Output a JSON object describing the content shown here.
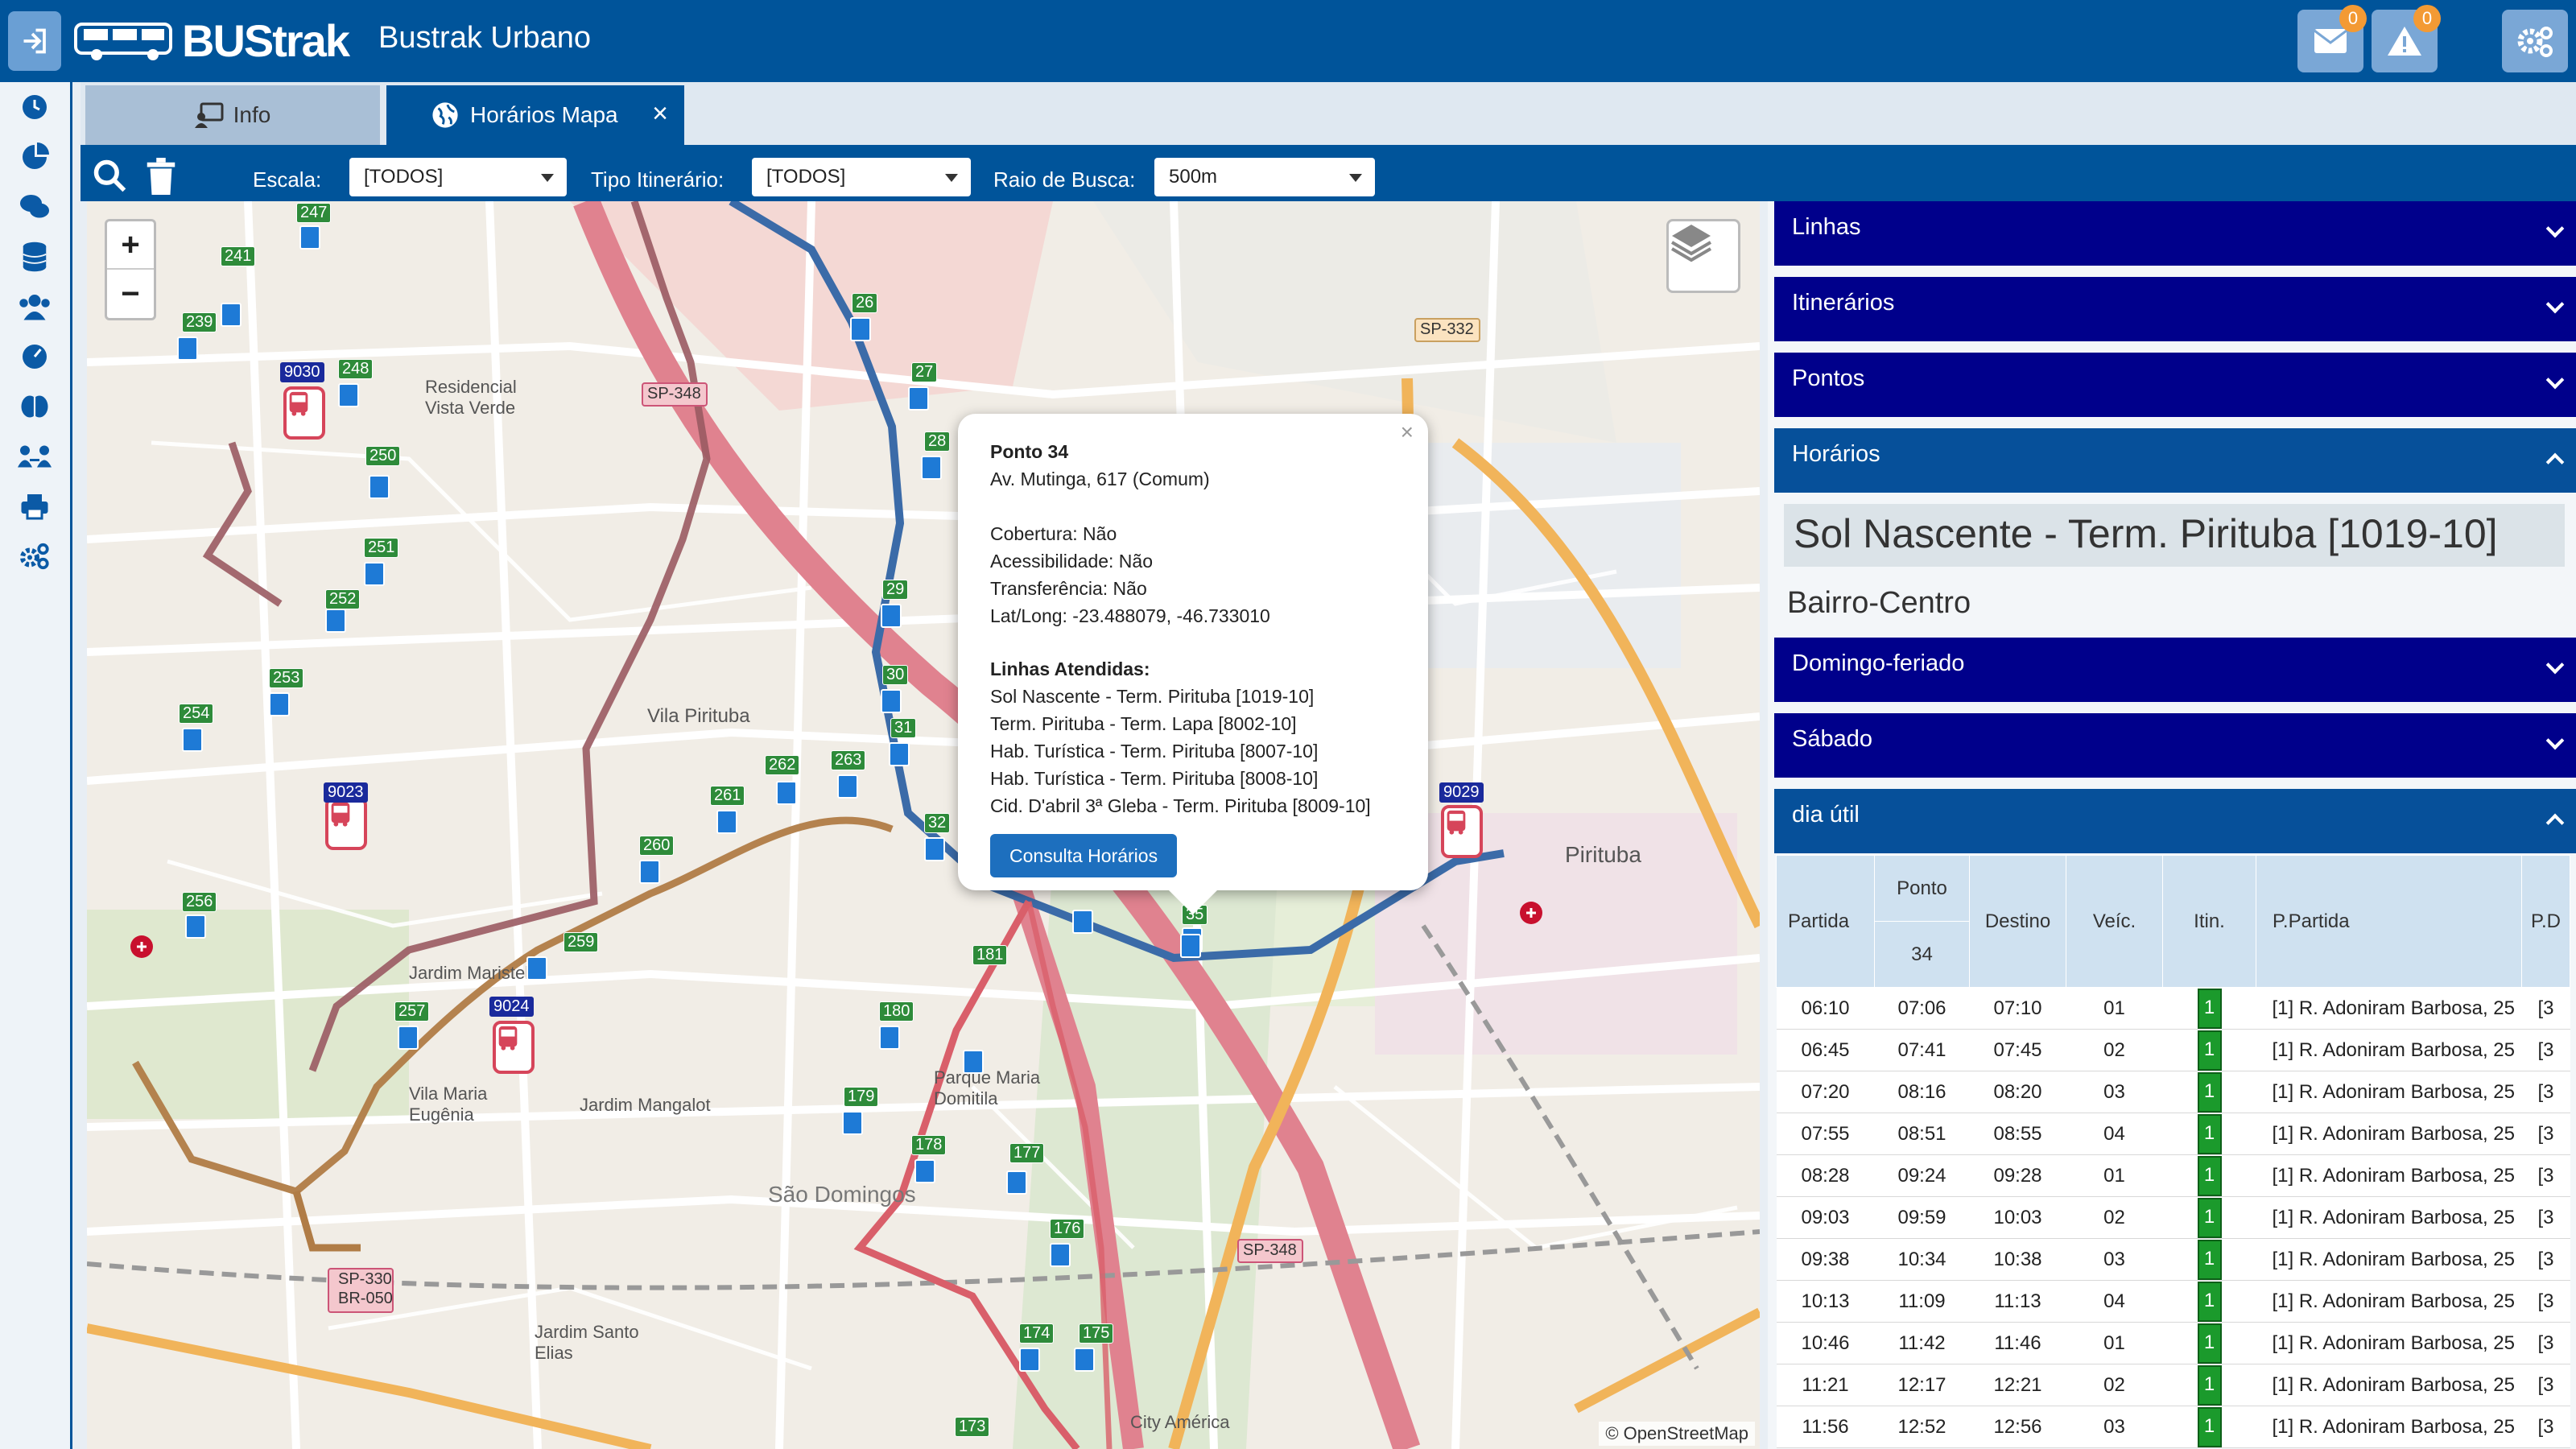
{
  "header": {
    "logo_text": "BUStrak",
    "app_title": "Bustrak Urbano",
    "messages_badge": "0",
    "alerts_badge": "0"
  },
  "tabs": [
    {
      "label": "Info"
    },
    {
      "label": "Horários Mapa"
    }
  ],
  "toolbar": {
    "escala_label": "Escala:",
    "escala_value": "[TODOS]",
    "tipo_label": "Tipo Itinerário:",
    "tipo_value": "[TODOS]",
    "raio_label": "Raio de Busca:",
    "raio_value": "500m"
  },
  "map": {
    "attribution": "© OpenStreetMap",
    "popup": {
      "title": "Ponto 34",
      "address": "Av. Mutinga, 617 (Comum)",
      "cobertura": "Cobertura: Não",
      "acessibilidade": "Acessibilidade: Não",
      "transferencia": "Transferência: Não",
      "latlong": "Lat/Long: -23.488079, -46.733010",
      "linhas_title": "Linhas Atendidas:",
      "linhas": [
        "Sol Nascente - Term. Pirituba [1019-10]",
        "Term. Pirituba - Term. Lapa [8002-10]",
        "Hab. Turística - Term. Pirituba [8007-10]",
        "Hab. Turística - Term. Pirituba [8008-10]",
        "Cid. D'abril 3ª Gleba - Term. Pirituba [8009-10]"
      ],
      "button": "Consulta Horários"
    },
    "labels": {
      "vila_pirituba": "Vila Pirituba",
      "sao_domingos": "São Domingos",
      "pirituba": "Pirituba",
      "jardim_mangalot": "Jardim Mangalot",
      "vila_maria_eugenia": "Vila Maria Eugênia",
      "jardim_maristela": "Jardim Maristela",
      "parque_maria_domitila": "Parque Maria Domitila",
      "residencial_vista_verde": "Residencial Vista Verde",
      "jardim_santo_elias": "Jardim Santo Elias",
      "city_america": "City América",
      "sp348": "SP-348",
      "sp332": "SP-332",
      "sp330": "SP-330",
      "br050": "BR-050"
    }
  },
  "panel": {
    "accordions": [
      "Linhas",
      "Itinerários",
      "Pontos",
      "Horários"
    ],
    "route_title": "Sol Nascente - Term. Pirituba [1019-10]",
    "route_sub": "Bairro-Centro",
    "sub_accordions": [
      "Domingo-feriado",
      "Sábado",
      "dia útil"
    ],
    "table": {
      "headers": [
        "Partida",
        "Ponto",
        "Destino",
        "Veíc.",
        "Itin.",
        "P.Partida",
        "P.D"
      ],
      "ponto_number": "34",
      "rows": [
        [
          "06:10",
          "07:06",
          "07:10",
          "01",
          "1",
          "[1] R. Adoniram Barbosa, 25",
          "[3"
        ],
        [
          "06:45",
          "07:41",
          "07:45",
          "02",
          "1",
          "[1] R. Adoniram Barbosa, 25",
          "[3"
        ],
        [
          "07:20",
          "08:16",
          "08:20",
          "03",
          "1",
          "[1] R. Adoniram Barbosa, 25",
          "[3"
        ],
        [
          "07:55",
          "08:51",
          "08:55",
          "04",
          "1",
          "[1] R. Adoniram Barbosa, 25",
          "[3"
        ],
        [
          "08:28",
          "09:24",
          "09:28",
          "01",
          "1",
          "[1] R. Adoniram Barbosa, 25",
          "[3"
        ],
        [
          "09:03",
          "09:59",
          "10:03",
          "02",
          "1",
          "[1] R. Adoniram Barbosa, 25",
          "[3"
        ],
        [
          "09:38",
          "10:34",
          "10:38",
          "03",
          "1",
          "[1] R. Adoniram Barbosa, 25",
          "[3"
        ],
        [
          "10:13",
          "11:09",
          "11:13",
          "04",
          "1",
          "[1] R. Adoniram Barbosa, 25",
          "[3"
        ],
        [
          "10:46",
          "11:42",
          "11:46",
          "01",
          "1",
          "[1] R. Adoniram Barbosa, 25",
          "[3"
        ],
        [
          "11:21",
          "12:17",
          "12:21",
          "02",
          "1",
          "[1] R. Adoniram Barbosa, 25",
          "[3"
        ],
        [
          "11:56",
          "12:52",
          "12:56",
          "03",
          "1",
          "[1] R. Adoniram Barbosa, 25",
          "[3"
        ]
      ]
    }
  },
  "colors": {
    "primary": "#00549a",
    "accordion": "#00008b",
    "itin_badge": "#1b9a2c",
    "badge": "#f39a34"
  }
}
